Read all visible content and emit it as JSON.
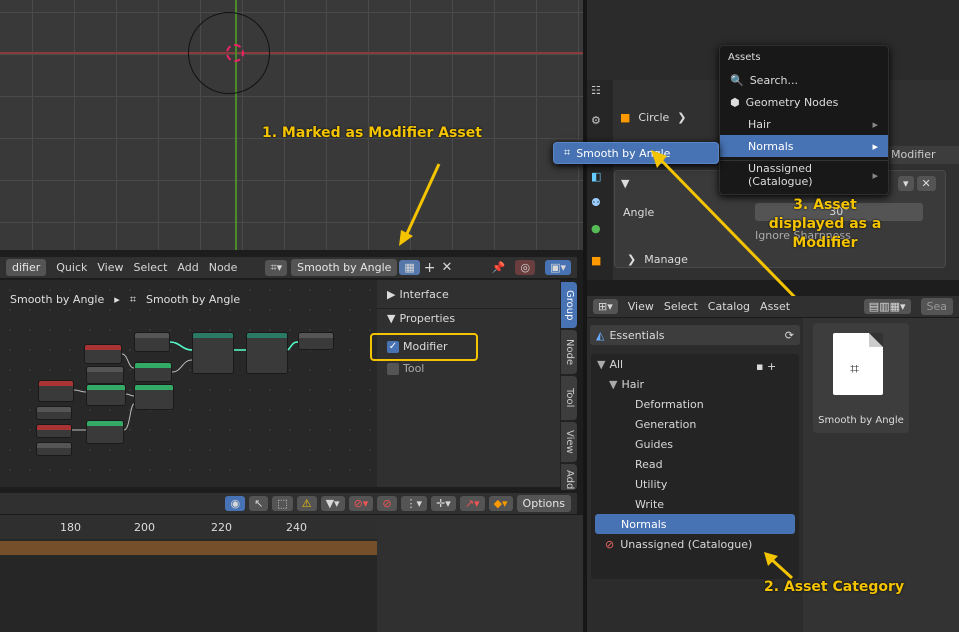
{
  "viewport_menu": {
    "mode": "difier",
    "items": [
      "Quick",
      "View",
      "Select",
      "Add",
      "Node"
    ],
    "group_name": "Smooth by Angle"
  },
  "node_editor": {
    "breadcrumb_left": "Smooth by Angle",
    "breadcrumb_sep": "▸",
    "breadcrumb_right": "Smooth by Angle"
  },
  "sidebar_panel": {
    "interface": "Interface",
    "properties": "Properties",
    "modifier": "Modifier",
    "tool": "Tool"
  },
  "vertical_tabs": [
    "Group",
    "Node",
    "Tool",
    "View",
    "Add"
  ],
  "timeline": {
    "ticks": [
      "180",
      "200",
      "220",
      "240"
    ],
    "options": "Options"
  },
  "annotations": {
    "one": "1. Marked as Modifier Asset",
    "two": "2. Asset Category",
    "three_line1": "3. Asset",
    "three_line2": "displayed as a",
    "three_line3": "Modifier"
  },
  "properties_editor": {
    "object": "Circle",
    "modifier_tag": "Modifier",
    "angle_label": "Angle",
    "angle_value": "30°",
    "ignore": "Ignore Sharpness",
    "manage": "Manage"
  },
  "assets_menu": {
    "title": "Assets",
    "items": [
      {
        "label": "Search...",
        "icon": "search-icon",
        "arrow": false
      },
      {
        "label": "Geometry Nodes",
        "icon": "nodes-icon",
        "arrow": false
      },
      {
        "label": "Hair",
        "icon": "",
        "arrow": true
      },
      {
        "label": "Normals",
        "icon": "",
        "arrow": true,
        "selected": true
      },
      {
        "label": "Unassigned (Catalogue)",
        "icon": "",
        "arrow": true
      }
    ]
  },
  "submenu": {
    "item": "Smooth by Angle"
  },
  "asset_browser": {
    "menu": [
      "View",
      "Select",
      "Catalog",
      "Asset"
    ],
    "search_placeholder": "Sea",
    "library": "Essentials",
    "tree": {
      "all": "All",
      "hair": "Hair",
      "children": [
        "Deformation",
        "Generation",
        "Guides",
        "Read",
        "Utility",
        "Write"
      ],
      "normals": "Normals",
      "unassigned": "Unassigned (Catalogue)"
    },
    "asset_name": "Smooth by Angle"
  },
  "colors": {
    "accent": "#4772b3",
    "annotation": "#f5c400"
  }
}
